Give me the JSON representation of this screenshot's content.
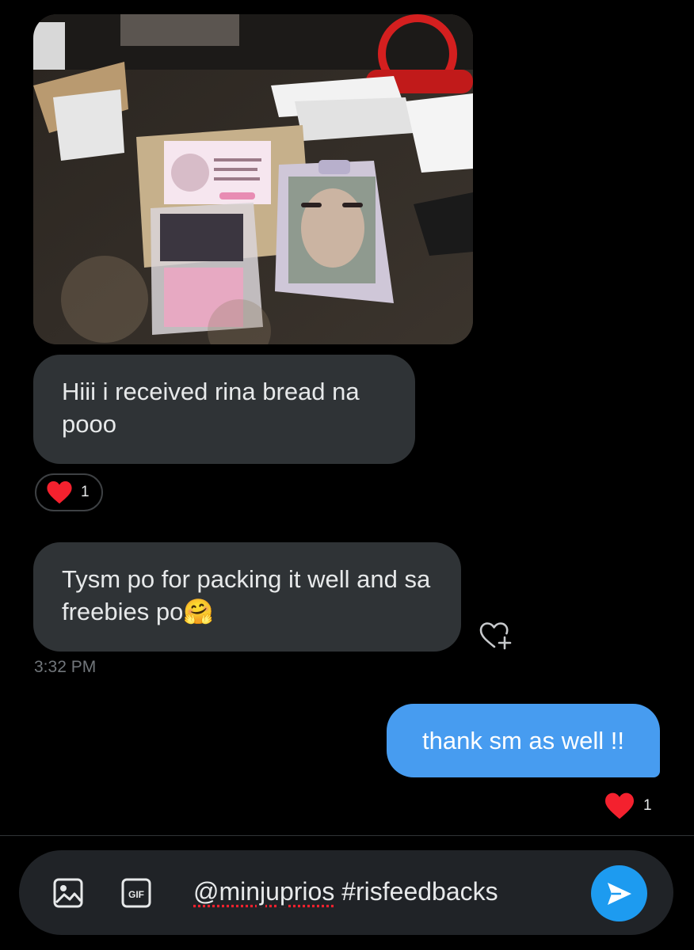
{
  "conversation": {
    "messages": [
      {
        "direction": "received",
        "type": "image",
        "alt": ""
      },
      {
        "direction": "received",
        "type": "text",
        "text": "Hiii i received rina bread na pooo",
        "reaction": {
          "emoji": "heart",
          "count": "1"
        }
      },
      {
        "direction": "received",
        "type": "text",
        "text": "Tysm po for packing it well and sa freebies po🤗",
        "timestamp": "3:32 PM"
      },
      {
        "direction": "sent",
        "type": "text",
        "text": "thank sm as well !!",
        "reaction": {
          "emoji": "heart",
          "count": "1"
        }
      }
    ]
  },
  "composer": {
    "draft_mention": "@minjuprios",
    "draft_rest": " #risfeedbacks",
    "gif_label": "GIF"
  },
  "icons": {
    "image": "image-icon",
    "gif": "gif-icon",
    "send": "send-icon",
    "add_reaction": "heart-plus-icon",
    "reaction_heart": "heart-icon"
  },
  "colors": {
    "background": "#000000",
    "received_bubble": "#2f3336",
    "sent_bubble": "#479cf0",
    "send_button": "#1d9bf0",
    "heart": "#f4212e",
    "timestamp": "#71767b"
  }
}
